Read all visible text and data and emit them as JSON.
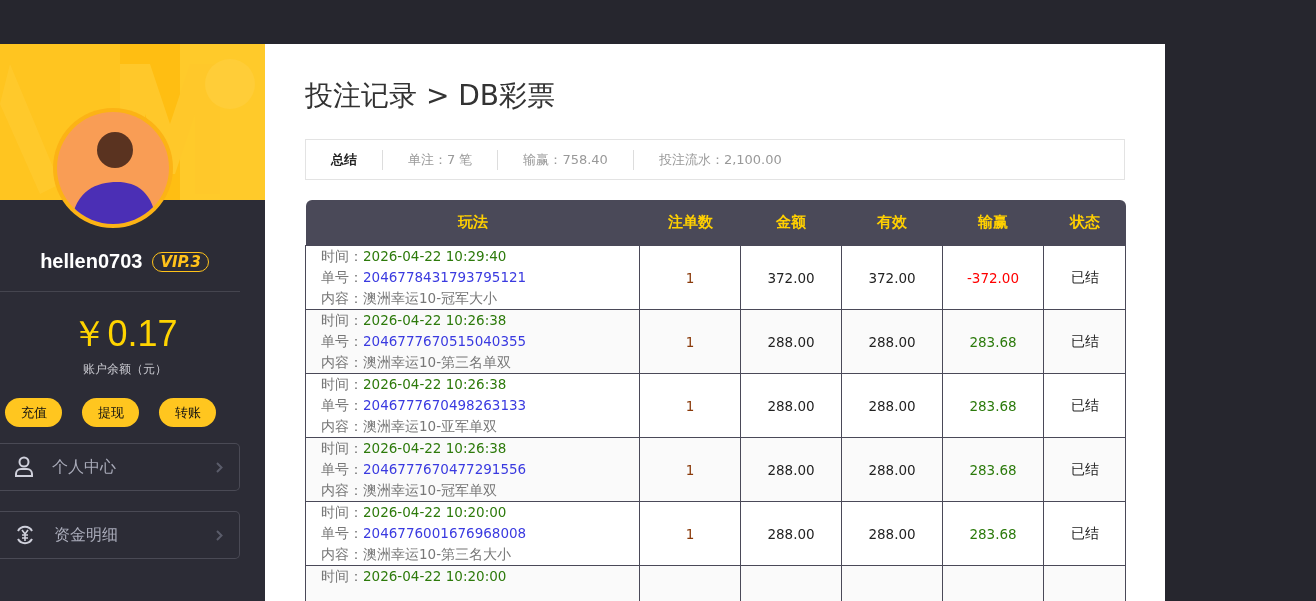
{
  "sidebar": {
    "username": "hellen0703",
    "vip": "VIP.3",
    "balance": "￥0.17",
    "balance_label": "账户余额（元）",
    "actions": [
      "充值",
      "提现",
      "转账"
    ],
    "menu": [
      {
        "label": "个人中心",
        "kind": "person"
      },
      {
        "label": "资金明细",
        "kind": "money"
      }
    ]
  },
  "page": {
    "title": "投注记录 > DB彩票"
  },
  "summary": {
    "label": "总结",
    "items": [
      "单注：7 笔",
      "输赢：758.40",
      "投注流水：2,100.00"
    ]
  },
  "table": {
    "columns": [
      "玩法",
      "注单数",
      "金额",
      "有效",
      "输赢",
      "状态"
    ],
    "rows": [
      {
        "time_label": "时间：",
        "time": "2026-04-22 10:29:40",
        "order_label": "单号：",
        "order": "2046778431793795121",
        "content_label": "内容：",
        "content": "澳洲幸运10-冠军大小",
        "count": "1",
        "amount": "372.00",
        "valid": "372.00",
        "result": "-372.00",
        "color": "#ff0000",
        "status": "已结"
      },
      {
        "time_label": "时间：",
        "time": "2026-04-22 10:26:38",
        "order_label": "单号：",
        "order": "2046777670515040355",
        "content_label": "内容：",
        "content": "澳洲幸运10-第三名单双",
        "count": "1",
        "amount": "288.00",
        "valid": "288.00",
        "result": "283.68",
        "color": "#2b7a0b",
        "status": "已结"
      },
      {
        "time_label": "时间：",
        "time": "2026-04-22 10:26:38",
        "order_label": "单号：",
        "order": "2046777670498263133",
        "content_label": "内容：",
        "content": "澳洲幸运10-亚军单双",
        "count": "1",
        "amount": "288.00",
        "valid": "288.00",
        "result": "283.68",
        "color": "#2b7a0b",
        "status": "已结"
      },
      {
        "time_label": "时间：",
        "time": "2026-04-22 10:26:38",
        "order_label": "单号：",
        "order": "2046777670477291556",
        "content_label": "内容：",
        "content": "澳洲幸运10-冠军单双",
        "count": "1",
        "amount": "288.00",
        "valid": "288.00",
        "result": "283.68",
        "color": "#2b7a0b",
        "status": "已结"
      },
      {
        "time_label": "时间：",
        "time": "2026-04-22 10:20:00",
        "order_label": "单号：",
        "order": "2046776001676968008",
        "content_label": "内容：",
        "content": "澳洲幸运10-第三名大小",
        "count": "1",
        "amount": "288.00",
        "valid": "288.00",
        "result": "283.68",
        "color": "#2b7a0b",
        "status": "已结"
      },
      {
        "time_label": "时间：",
        "time": "2026-04-22 10:20:00"
      }
    ]
  }
}
